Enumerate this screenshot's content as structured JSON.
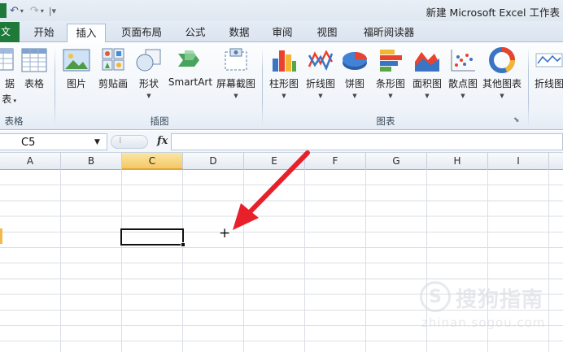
{
  "window": {
    "title": "新建 Microsoft Excel 工作表"
  },
  "tabs": [
    {
      "label": "文件"
    },
    {
      "label": "开始"
    },
    {
      "label": "插入",
      "active": true
    },
    {
      "label": "页面布局"
    },
    {
      "label": "公式"
    },
    {
      "label": "数据"
    },
    {
      "label": "审阅"
    },
    {
      "label": "视图"
    },
    {
      "label": "福昕阅读器"
    }
  ],
  "ribbon": {
    "tables_group": {
      "label": "表格",
      "pivot_label_top": "据",
      "pivot_label_bottom": "表",
      "table_label": "表格"
    },
    "illustrations_group": {
      "label": "插图",
      "picture": "图片",
      "clipart": "剪贴画",
      "shapes": "形状",
      "smartart": "SmartArt",
      "screenshot": "屏幕截图"
    },
    "charts_group": {
      "label": "图表",
      "column": "柱形图",
      "line": "折线图",
      "pie": "饼图",
      "bar": "条形图",
      "area": "面积图",
      "scatter": "散点图",
      "other": "其他图表"
    },
    "sparklines_group": {
      "line": "折线图"
    }
  },
  "formula_bar": {
    "name_box": "C5",
    "fx": "fx",
    "formula": ""
  },
  "sheet": {
    "columns": [
      "A",
      "B",
      "C",
      "D",
      "E",
      "F",
      "G",
      "H",
      "I"
    ],
    "selected_column": "C",
    "active_cell": "C5"
  },
  "watermark": {
    "title": "搜狗指南",
    "url": "zhinan.sogou.com"
  },
  "colors": {
    "file_tab": "#1f7a3a",
    "selected_header": "#f4c866",
    "arrow": "#e8202a"
  }
}
